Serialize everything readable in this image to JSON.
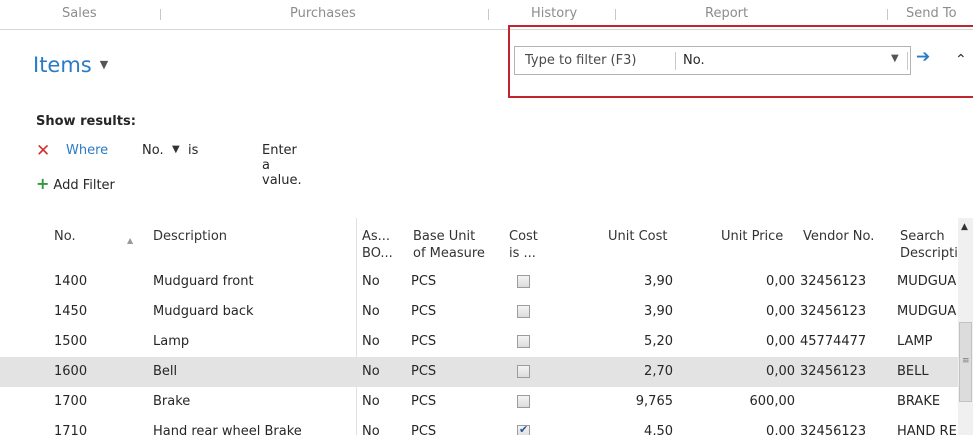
{
  "ribbon": {
    "tabs": [
      "Sales",
      "Purchases",
      "History",
      "Report",
      "Send To"
    ]
  },
  "page": {
    "title": "Items"
  },
  "filter_bar": {
    "placeholder": "Type to filter (F3)",
    "field": "No."
  },
  "filters": {
    "show_results": "Show results:",
    "where": "Where",
    "field": "No.",
    "operator": "is",
    "value": "Enter a value.",
    "add_filter": "Add Filter"
  },
  "grid": {
    "columns": {
      "no": "No.",
      "description": "Description",
      "assembly_1": "As...",
      "assembly_2": "BO...",
      "base_unit_1": "Base Unit",
      "base_unit_2": "of Measure",
      "cost_1": "Cost",
      "cost_2": "is ...",
      "unit_cost": "Unit Cost",
      "unit_price": "Unit Price",
      "vendor_no": "Vendor No.",
      "search_1": "Search",
      "search_2": "Descripti"
    },
    "rows": [
      {
        "no": "1400",
        "description": "Mudguard front",
        "assembly": "No",
        "unit": "PCS",
        "cost_adjusted": false,
        "unit_cost": "3,90",
        "unit_price": "0,00",
        "vendor": "32456123",
        "search": "MUDGUA"
      },
      {
        "no": "1450",
        "description": "Mudguard back",
        "assembly": "No",
        "unit": "PCS",
        "cost_adjusted": false,
        "unit_cost": "3,90",
        "unit_price": "0,00",
        "vendor": "32456123",
        "search": "MUDGUA"
      },
      {
        "no": "1500",
        "description": "Lamp",
        "assembly": "No",
        "unit": "PCS",
        "cost_adjusted": false,
        "unit_cost": "5,20",
        "unit_price": "0,00",
        "vendor": "45774477",
        "search": "LAMP"
      },
      {
        "no": "1600",
        "description": "Bell",
        "assembly": "No",
        "unit": "PCS",
        "cost_adjusted": false,
        "unit_cost": "2,70",
        "unit_price": "0,00",
        "vendor": "32456123",
        "search": "BELL"
      },
      {
        "no": "1700",
        "description": "Brake",
        "assembly": "No",
        "unit": "PCS",
        "cost_adjusted": false,
        "unit_cost": "9,765",
        "unit_price": "600,00",
        "vendor": "",
        "search": "BRAKE"
      },
      {
        "no": "1710",
        "description": "Hand rear wheel Brake",
        "assembly": "No",
        "unit": "PCS",
        "cost_adjusted": true,
        "unit_cost": "4,50",
        "unit_price": "0,00",
        "vendor": "32456123",
        "search": "HAND RE"
      }
    ],
    "selected_row": 3
  },
  "icons": {
    "title_caret": "chevron-down-icon",
    "filter_dropdown": "chevron-down-icon",
    "filter_go": "arrow-right-icon",
    "collapse": "chevron-up-icon",
    "remove_filter": "close-icon",
    "add_filter": "plus-icon",
    "sort": "sort-ascending-icon"
  },
  "colors": {
    "accent": "#2b7bc4",
    "highlight_box": "#c0262f",
    "remove": "#d3302f",
    "add": "#2e9a3b",
    "selected_row": "#e3e3e3"
  }
}
